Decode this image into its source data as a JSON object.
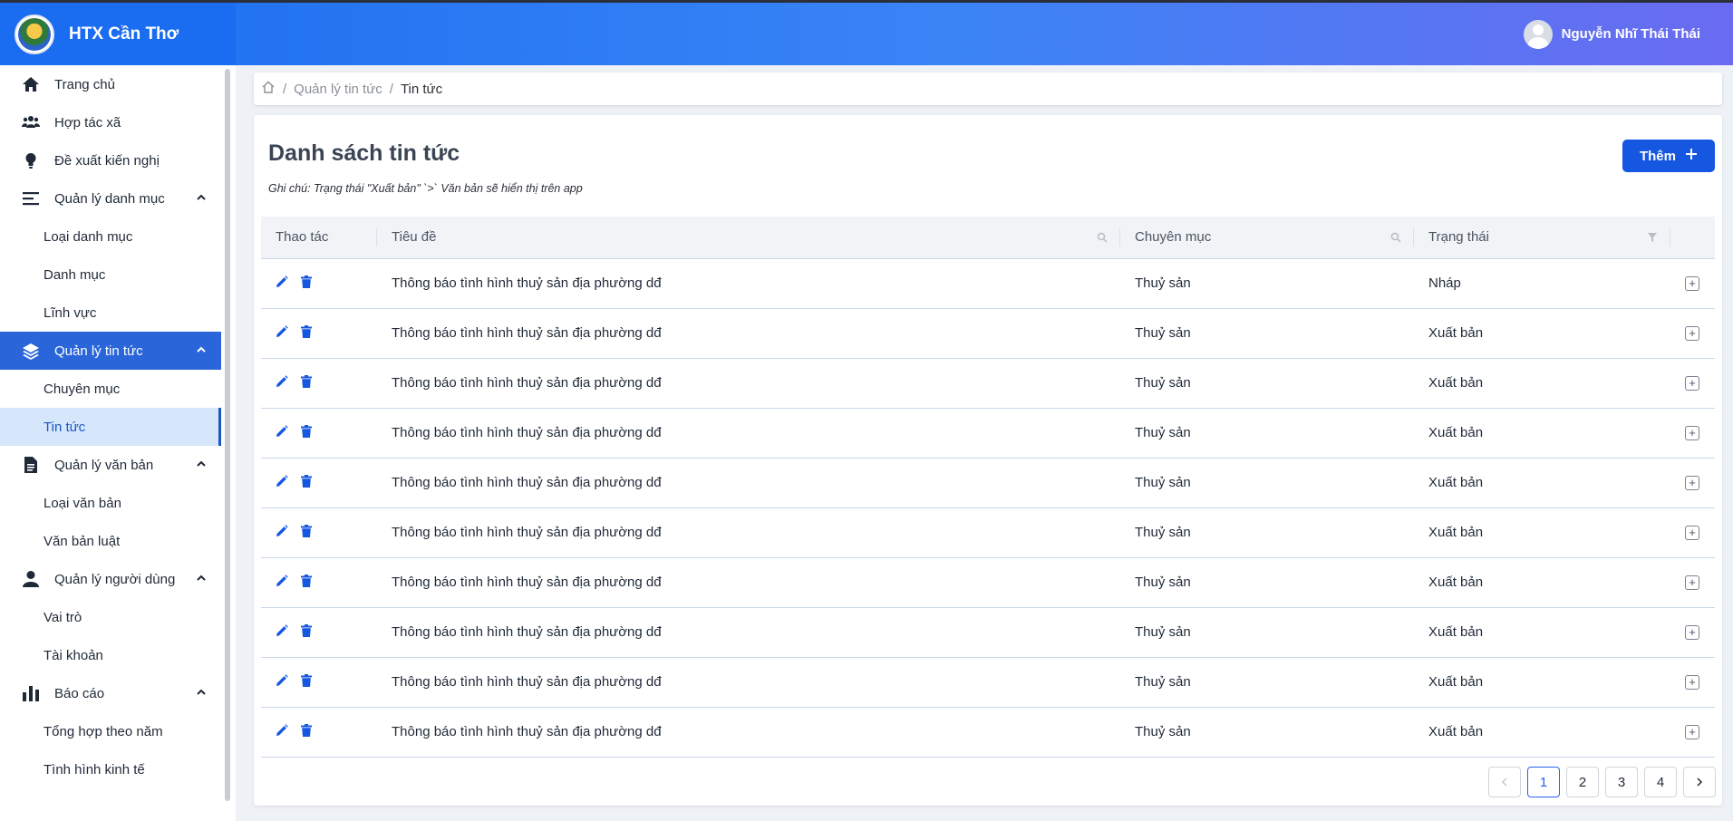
{
  "app": {
    "brand_name": "HTX Cần Thơ",
    "user_name": "Nguyễn Nhĩ Thái Thái"
  },
  "colors": {
    "header_start": "#1b6ef0",
    "header_end": "#6a6bf0",
    "primary": "#1557e0",
    "active_nav": "#2a66d9",
    "active_sub_bg": "#d6e6fb"
  },
  "sidebar": {
    "items": [
      {
        "label": "Trang chủ",
        "icon": "home-icon"
      },
      {
        "label": "Hợp tác xã",
        "icon": "users-icon"
      },
      {
        "label": "Đề xuất kiến nghị",
        "icon": "lightbulb-icon"
      },
      {
        "label": "Quản lý danh mục",
        "icon": "menu-icon",
        "sub": [
          "Loại danh mục",
          "Danh mục",
          "Lĩnh vực"
        ]
      },
      {
        "label": "Quản lý tin tức",
        "icon": "layers-icon",
        "sub": [
          "Chuyên mục",
          "Tin tức"
        ]
      },
      {
        "label": "Quản lý văn bản",
        "icon": "document-icon",
        "sub": [
          "Loại văn bản",
          "Văn bản luật"
        ]
      },
      {
        "label": "Quản lý người dùng",
        "icon": "user-icon",
        "sub": [
          "Vai trò",
          "Tài khoản"
        ]
      },
      {
        "label": "Báo cáo",
        "icon": "bar-chart-icon",
        "sub": [
          "Tổng hợp theo năm",
          "Tình hình kinh tế"
        ]
      }
    ]
  },
  "breadcrumb": {
    "parent": "Quản lý tin tức",
    "current": "Tin tức"
  },
  "page": {
    "title": "Danh sách tin tức",
    "note": "Ghi chú: Trạng thái \"Xuất bản\" `>` Văn bản sẽ hiển thị trên app",
    "add_label": "Thêm"
  },
  "table": {
    "headers": [
      "Thao tác",
      "Tiêu đề",
      "Chuyên mục",
      "Trạng thái"
    ],
    "rows": [
      {
        "title": "Thông báo tình hình thuỷ sản địa phường dđ",
        "category": "Thuỷ sản",
        "status": "Nháp"
      },
      {
        "title": "Thông báo tình hình thuỷ sản địa phường dđ",
        "category": "Thuỷ sản",
        "status": "Xuất bản"
      },
      {
        "title": "Thông báo tình hình thuỷ sản địa phường dđ",
        "category": "Thuỷ sản",
        "status": "Xuất bản"
      },
      {
        "title": "Thông báo tình hình thuỷ sản địa phường dđ",
        "category": "Thuỷ sản",
        "status": "Xuất bản"
      },
      {
        "title": "Thông báo tình hình thuỷ sản địa phường dđ",
        "category": "Thuỷ sản",
        "status": "Xuất bản"
      },
      {
        "title": "Thông báo tình hình thuỷ sản địa phường dđ",
        "category": "Thuỷ sản",
        "status": "Xuất bản"
      },
      {
        "title": "Thông báo tình hình thuỷ sản địa phường dđ",
        "category": "Thuỷ sản",
        "status": "Xuất bản"
      },
      {
        "title": "Thông báo tình hình thuỷ sản địa phường dđ",
        "category": "Thuỷ sản",
        "status": "Xuất bản"
      },
      {
        "title": "Thông báo tình hình thuỷ sản địa phường dđ",
        "category": "Thuỷ sản",
        "status": "Xuất bản"
      },
      {
        "title": "Thông báo tình hình thuỷ sản địa phường dđ",
        "category": "Thuỷ sản",
        "status": "Xuất bản"
      }
    ]
  },
  "pagination": {
    "pages": [
      "1",
      "2",
      "3",
      "4"
    ],
    "current": "1"
  }
}
